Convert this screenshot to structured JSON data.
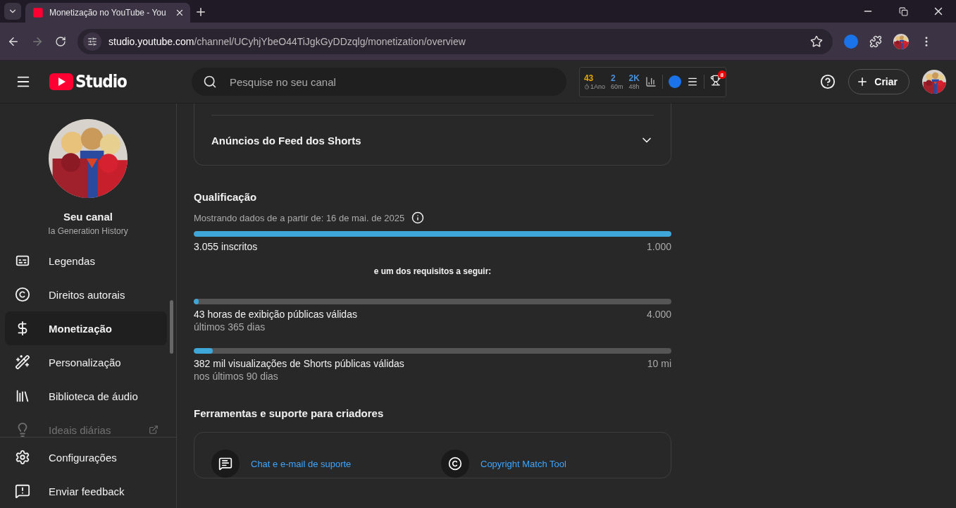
{
  "browser": {
    "tab_title": "Monetização no YouTube - You",
    "url_host": "studio.youtube.com",
    "url_path": "/channel/UCyhjYbeO44TiJgkGyDDzqlg/monetization/overview"
  },
  "header": {
    "logo": "Studio",
    "search_placeholder": "Pesquise no seu canal",
    "stats": [
      {
        "value": "43",
        "label": "1Ano",
        "color": "#e0a800",
        "timer": true
      },
      {
        "value": "2",
        "label": "60m",
        "color": "#4a90d9",
        "timer": false
      },
      {
        "value": "2K",
        "label": "48h",
        "color": "#4a90d9",
        "timer": false
      }
    ],
    "badge": "8",
    "create_label": "Criar"
  },
  "sidebar": {
    "channel_title": "Seu canal",
    "channel_name": "Ia Generation History",
    "items": [
      {
        "kind": "captions",
        "label": "Legendas",
        "selected": false,
        "faded": false
      },
      {
        "kind": "copyright",
        "label": "Direitos autorais",
        "selected": false,
        "faded": false
      },
      {
        "kind": "money",
        "label": "Monetização",
        "selected": true,
        "faded": false
      },
      {
        "kind": "wand",
        "label": "Personalização",
        "selected": false,
        "faded": false
      },
      {
        "kind": "library",
        "label": "Biblioteca de áudio",
        "selected": false,
        "faded": false
      },
      {
        "kind": "ideas",
        "label": "Ideais diárias",
        "selected": false,
        "faded": true
      }
    ],
    "footer": [
      {
        "kind": "settings",
        "label": "Configurações"
      },
      {
        "kind": "feedback",
        "label": "Enviar feedback"
      }
    ]
  },
  "accordion": {
    "label": "Anúncios do Feed dos Shorts",
    "expanded": false
  },
  "qualification": {
    "title": "Qualificação",
    "note": "Mostrando dados de a partir de: 16 de mai. de 2025",
    "main": {
      "level": 1,
      "label": "3.055 inscritos",
      "target": "1.000"
    },
    "separator": "e um dos requisitos a seguir:",
    "requirements": [
      {
        "level": 0.011,
        "label": "43 horas de exibição públicas válidas",
        "target": "4.000",
        "sub": "últimos 365 dias"
      },
      {
        "level": 0.04,
        "label": "382 mil visualizações de Shorts públicas válidas",
        "target": "10 mi",
        "sub": "nos últimos 90 dias"
      }
    ]
  },
  "tools": {
    "title": "Ferramentas e suporte para criadores",
    "links": [
      {
        "kind": "chat",
        "label": "Chat e e-mail de suporte"
      },
      {
        "kind": "copyright",
        "label": "Copyright Match Tool"
      }
    ]
  }
}
